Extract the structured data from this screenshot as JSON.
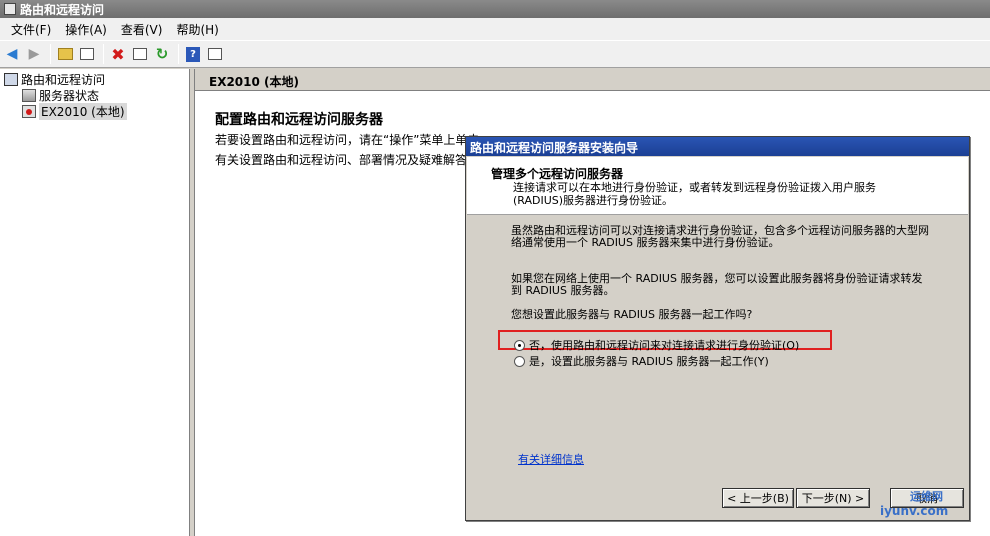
{
  "window": {
    "title": "路由和远程访问"
  },
  "menu": [
    "文件(F)",
    "操作(A)",
    "查看(V)",
    "帮助(H)"
  ],
  "tree": {
    "root": "路由和远程访问",
    "children": [
      "服务器状态",
      "EX2010 (本地)"
    ]
  },
  "right": {
    "header": "EX2010 (本地)",
    "title": "配置路由和远程访问服务器",
    "line1": "若要设置路由和远程访问，请在“操作”菜单上单击",
    "line2": "有关设置路由和远程访问、部署情况及疑难解答"
  },
  "dialog": {
    "title": "路由和远程访问服务器安装向导",
    "heading": "管理多个远程访问服务器",
    "subheading": "连接请求可以在本地进行身份验证，或者转发到远程身份验证拨入用户服务(RADIUS)服务器进行身份验证。",
    "para1": "虽然路由和远程访问可以对连接请求进行身份验证，包含多个远程访问服务器的大型网络通常使用一个 RADIUS 服务器来集中进行身份验证。",
    "para2": "如果您在网络上使用一个 RADIUS 服务器，您可以设置此服务器将身份验证请求转发到 RADIUS 服务器。",
    "question": "您想设置此服务器与 RADIUS 服务器一起工作吗?",
    "option_no": "否，使用路由和远程访问来对连接请求进行身份验证(O)",
    "option_yes": "是，设置此服务器与 RADIUS 服务器一起工作(Y)",
    "link": "有关详细信息",
    "btn_back": "< 上一步(B)",
    "btn_next": "下一步(N) >",
    "btn_cancel": "取消"
  },
  "watermark": {
    "line1": "运维网",
    "line2": "iyunv.com"
  }
}
